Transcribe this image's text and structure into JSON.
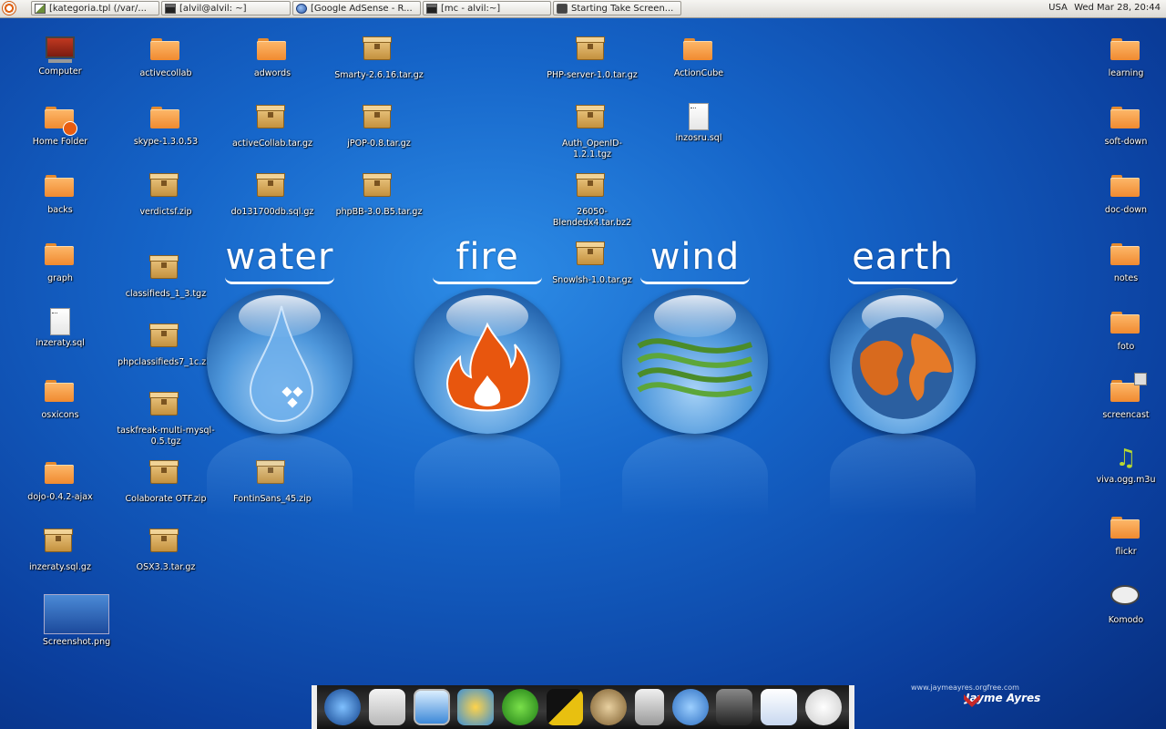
{
  "panel": {
    "tasks": [
      {
        "label": "[kategoria.tpl (/var/...",
        "icon": "text-editor-icon"
      },
      {
        "label": "[alvil@alvil: ~]",
        "icon": "terminal-icon"
      },
      {
        "label": "[Google AdSense - R...",
        "icon": "browser-icon"
      },
      {
        "label": "[mc - alvil:~]",
        "icon": "terminal-icon"
      },
      {
        "label": "Starting Take Screen...",
        "icon": "camera-icon"
      }
    ],
    "keyboard_layout": "USA",
    "clock": "Wed Mar 28, 20:44"
  },
  "desktop_icons": [
    {
      "label": "Computer",
      "type": "computer"
    },
    {
      "label": "Home Folder",
      "type": "home"
    },
    {
      "label": "backs",
      "type": "folder"
    },
    {
      "label": "graph",
      "type": "folder"
    },
    {
      "label": "inzeraty.sql",
      "type": "doc"
    },
    {
      "label": "osxicons",
      "type": "folder"
    },
    {
      "label": "dojo-0.4.2-ajax",
      "type": "folder"
    },
    {
      "label": "inzeraty.sql.gz",
      "type": "package"
    },
    {
      "label": "Screenshot.png",
      "type": "image"
    },
    {
      "label": "activecollab",
      "type": "folder"
    },
    {
      "label": "skype-1.3.0.53",
      "type": "folder"
    },
    {
      "label": "verdictsf.zip",
      "type": "package"
    },
    {
      "label": "classifieds_1_3.tgz",
      "type": "package"
    },
    {
      "label": "phpclassifieds7_1c.zip",
      "type": "package"
    },
    {
      "label": "taskfreak-multi-mysql-0.5.tgz",
      "type": "package"
    },
    {
      "label": "Colaborate OTF.zip",
      "type": "package"
    },
    {
      "label": "OSX3.3.tar.gz",
      "type": "package"
    },
    {
      "label": "adwords",
      "type": "folder"
    },
    {
      "label": "activeCollab.tar.gz",
      "type": "package"
    },
    {
      "label": "do131700db.sql.gz",
      "type": "package"
    },
    {
      "label": "FontinSans_45.zip",
      "type": "package"
    },
    {
      "label": "Smarty-2.6.16.tar.gz",
      "type": "package"
    },
    {
      "label": "jPOP-0.8.tar.gz",
      "type": "package"
    },
    {
      "label": "phpBB-3.0.B5.tar.gz",
      "type": "package"
    },
    {
      "label": "PHP-server-1.0.tar.gz",
      "type": "package"
    },
    {
      "label": "Auth_OpenID-1.2.1.tgz",
      "type": "package"
    },
    {
      "label": "26050-Blendedx4.tar.bz2",
      "type": "package"
    },
    {
      "label": "Snowlsh-1.0.tar.gz",
      "type": "package"
    },
    {
      "label": "ActionCube",
      "type": "folder"
    },
    {
      "label": "inzosru.sql",
      "type": "doc"
    },
    {
      "label": "learning",
      "type": "folder"
    },
    {
      "label": "soft-down",
      "type": "folder"
    },
    {
      "label": "doc-down",
      "type": "folder"
    },
    {
      "label": "notes",
      "type": "folder"
    },
    {
      "label": "foto",
      "type": "folder"
    },
    {
      "label": "screencast",
      "type": "folder-shared"
    },
    {
      "label": "viva.ogg.m3u",
      "type": "music"
    },
    {
      "label": "flickr",
      "type": "folder"
    },
    {
      "label": "Komodo",
      "type": "komodo"
    }
  ],
  "elements": [
    {
      "word": "water",
      "icon": "water-drop-icon"
    },
    {
      "word": "fire",
      "icon": "flame-icon"
    },
    {
      "word": "wind",
      "icon": "wind-waves-icon"
    },
    {
      "word": "earth",
      "icon": "globe-icon"
    }
  ],
  "dock": [
    "browser-icon",
    "mail-icon",
    "display-icon",
    "photo-icon",
    "inkscape-icon",
    "terminal-icon",
    "gimp-icon",
    "calculator-icon",
    "messenger-icon",
    "camera-icon",
    "notes-icon",
    "ghost-icon"
  ],
  "signature": {
    "url": "www.jaymeayres.orgfree.com",
    "name": "Jayme Ayres"
  },
  "colors": {
    "desktop": "#1564c8",
    "folder": "#f08a30",
    "accent": "#e06010"
  }
}
